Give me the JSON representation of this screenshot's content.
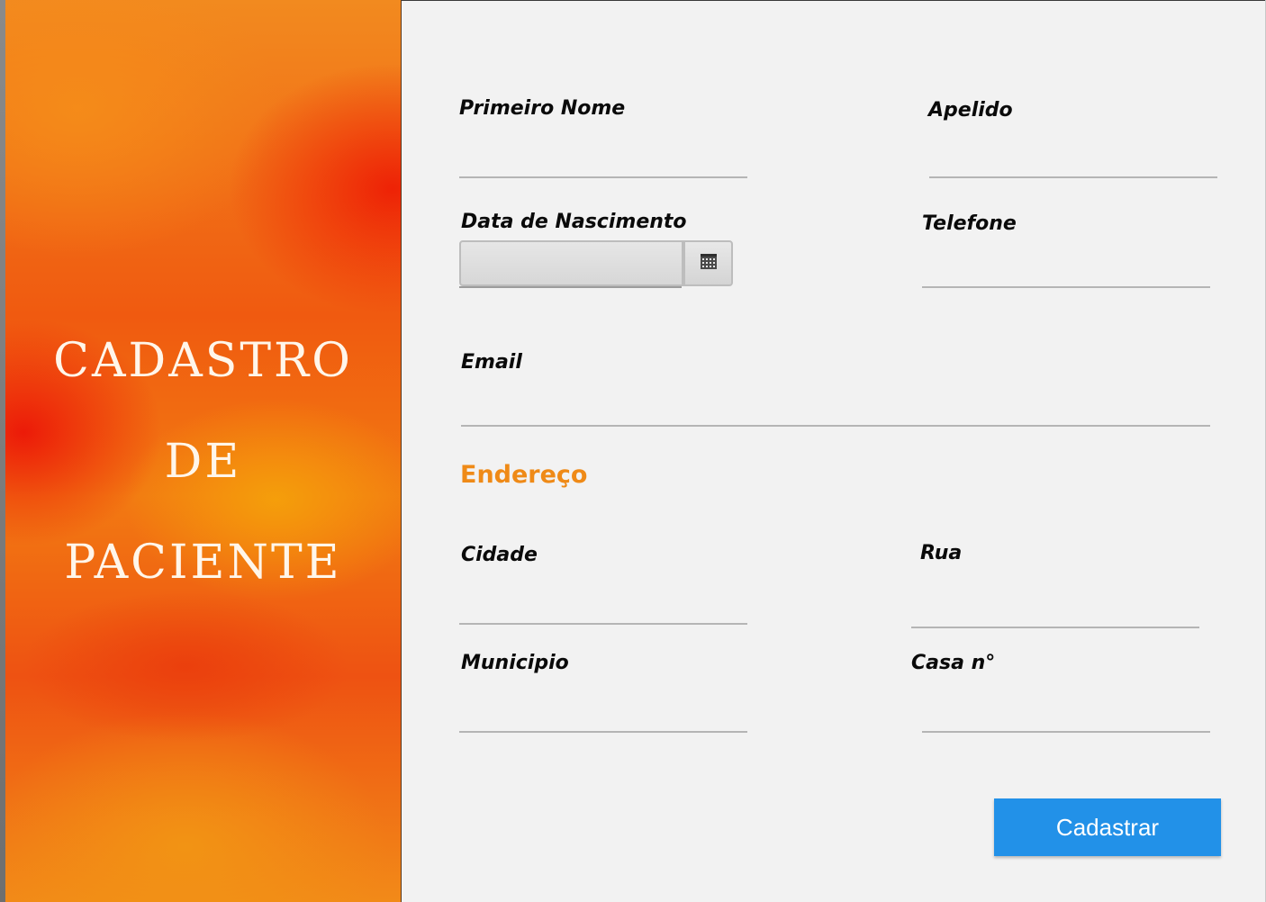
{
  "banner": {
    "title_lines": [
      "CADASTRO",
      "DE",
      "PACIENTE"
    ]
  },
  "form": {
    "first_name": {
      "label": "Primeiro Nome",
      "value": ""
    },
    "surname": {
      "label": "Apelido",
      "value": ""
    },
    "birth_date": {
      "label": "Data de Nascimento",
      "value": ""
    },
    "phone": {
      "label": "Telefone",
      "value": ""
    },
    "email": {
      "label": "Email",
      "value": ""
    },
    "address_heading": "Endereço",
    "city": {
      "label": "Cidade",
      "value": ""
    },
    "street": {
      "label": "Rua",
      "value": ""
    },
    "municipality": {
      "label": "Municipio",
      "value": ""
    },
    "house_number": {
      "label": "Casa n°",
      "value": ""
    },
    "submit_label": "Cadastrar"
  },
  "icons": {
    "calendar": "calendar-icon"
  },
  "colors": {
    "accent_orange": "#ef8a17",
    "button_blue": "#2291e8",
    "background": "#f2f2f2"
  }
}
